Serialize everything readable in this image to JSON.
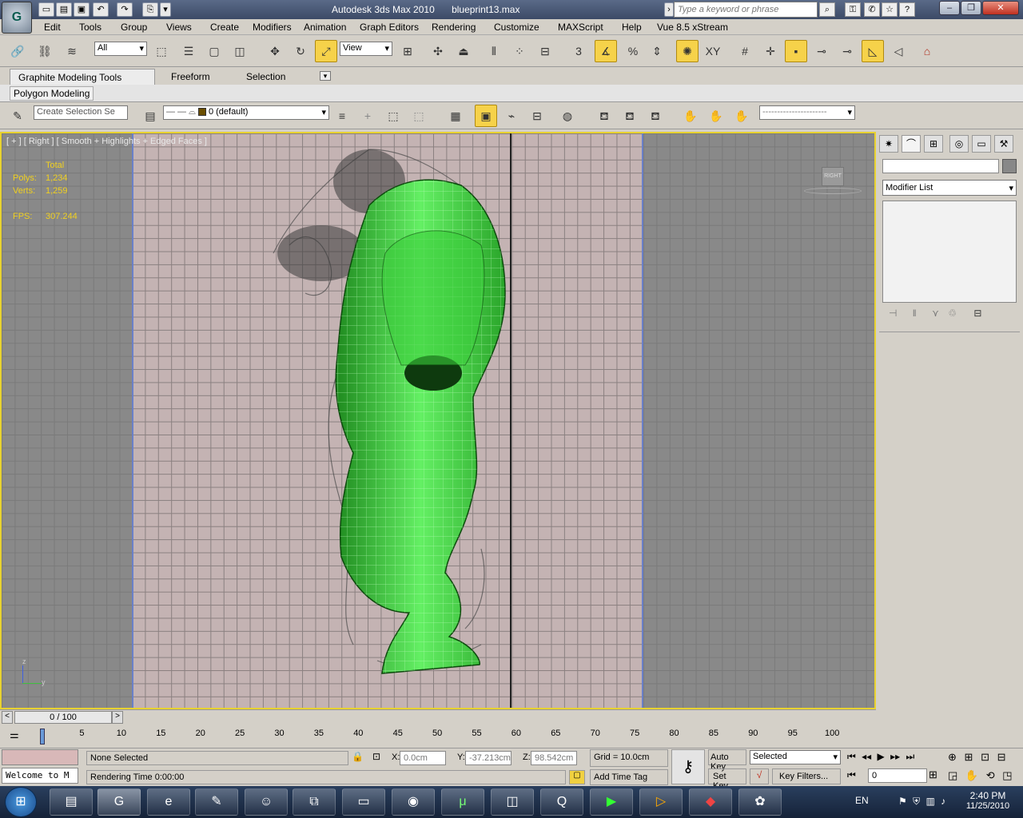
{
  "titlebar": {
    "app": "Autodesk 3ds Max  2010",
    "file": "blueprint13.max",
    "search_placeholder": "Type a keyword or phrase",
    "logo_glyph": "G"
  },
  "menu": {
    "items": [
      "Edit",
      "Tools",
      "Group",
      "Views",
      "Create",
      "Modifiers",
      "Animation",
      "Graph Editors",
      "Rendering",
      "Customize",
      "MAXScript",
      "Help",
      "Vue 8.5 xStream"
    ]
  },
  "toolbar": {
    "selection_filter": "All",
    "ref_coord": "View",
    "snap_label": "3",
    "xy_label": "XY"
  },
  "ribbon": {
    "tabs": [
      "Graphite Modeling Tools",
      "Freeform",
      "Selection"
    ],
    "panel": "Polygon Modeling"
  },
  "layers": {
    "selection_set_placeholder": "Create Selection Se",
    "current_layer": "0 (default)"
  },
  "viewport": {
    "label": "[ + ] [ Right ] [ Smooth + Highlights + Edged Faces ]",
    "stats": {
      "header": "Total",
      "polys_label": "Polys:",
      "polys_value": "1,234",
      "verts_label": "Verts:",
      "verts_value": "1,259",
      "fps_label": "FPS:",
      "fps_value": "307.244"
    },
    "viewcube_label": "RIGHT",
    "axis_z": "z",
    "axis_y": "y",
    "colors": {
      "border": "#e8d230",
      "mesh": "#4ee04e",
      "stats": "#f0d020"
    }
  },
  "command_panel": {
    "modifier_list": "Modifier List"
  },
  "timeline": {
    "frame_display": "0 / 100",
    "ticks": [
      "0",
      "5",
      "10",
      "15",
      "20",
      "25",
      "30",
      "35",
      "40",
      "45",
      "50",
      "55",
      "60",
      "65",
      "70",
      "75",
      "80",
      "85",
      "90",
      "95",
      "100"
    ]
  },
  "status": {
    "selection": "None Selected",
    "prompt": "Rendering Time  0:00:00",
    "maxscript": "Welcome to M",
    "x_label": "X:",
    "x_value": "0.0cm",
    "y_label": "Y:",
    "y_value": "-37.213cm",
    "z_label": "Z:",
    "z_value": "98.542cm",
    "grid": "Grid = 10.0cm",
    "add_time_tag": "Add Time Tag",
    "auto_key": "Auto Key",
    "set_key": "Set Key",
    "key_mode": "Selected",
    "key_filters": "Key Filters...",
    "current_frame": "0"
  },
  "taskbar": {
    "lang": "EN",
    "time": "2:40 PM",
    "date": "11/25/2010"
  }
}
